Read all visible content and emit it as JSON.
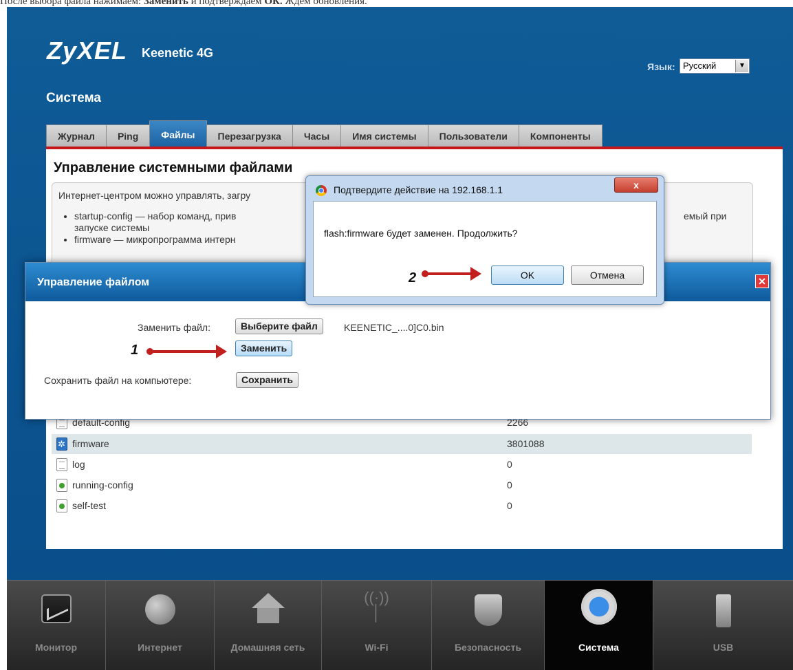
{
  "caption": {
    "before": "После выбора файла нажимаем: ",
    "bold1": "Заменить",
    "middle": " и подтверждаем ",
    "bold2": "ОК.",
    "after": " Ждем обновления."
  },
  "header": {
    "brand": "ZyXEL",
    "model": "Keenetic 4G",
    "language_label": "Язык:",
    "language_value": "Русский",
    "section_title": "Система"
  },
  "tabs": [
    "Журнал",
    "Ping",
    "Файлы",
    "Перезагрузка",
    "Часы",
    "Имя системы",
    "Пользователи",
    "Компоненты"
  ],
  "active_tab": "Файлы",
  "content": {
    "heading": "Управление системными файлами",
    "intro": "Интернет-центром можно управлять, загру",
    "items": [
      {
        "text": "startup-config — набор команд, прив",
        "suffix": "емый при",
        "cont": "запуске системы"
      },
      {
        "text": "firmware — микропрограмма интерн"
      }
    ]
  },
  "files": [
    {
      "name": "default-config",
      "size": "2266",
      "icon": "doc"
    },
    {
      "name": "firmware",
      "size": "3801088",
      "icon": "gear",
      "highlight": true
    },
    {
      "name": "log",
      "size": "0",
      "icon": "doc"
    },
    {
      "name": "running-config",
      "size": "0",
      "icon": "green"
    },
    {
      "name": "self-test",
      "size": "0",
      "icon": "green"
    }
  ],
  "file_dialog": {
    "title": "Управление файлом",
    "replace_label": "Заменить файл:",
    "choose_button": "Выберите файл",
    "chosen_file": "KEENETIC_....0]C0.bin",
    "replace_button": "Заменить",
    "save_label": "Сохранить файл на компьютере:",
    "save_button": "Сохранить"
  },
  "confirm": {
    "title": "Подтвердите действие на 192.168.1.1",
    "close": "x",
    "message": "flash:firmware будет заменен. Продолжить?",
    "ok": "OK",
    "cancel": "Отмена"
  },
  "steps": [
    "1",
    "2"
  ],
  "bottom_nav": [
    {
      "label": "Монитор",
      "icon": "monitor-icon"
    },
    {
      "label": "Интернет",
      "icon": "globe-icon"
    },
    {
      "label": "Домашняя сеть",
      "icon": "home-icon"
    },
    {
      "label": "Wi-Fi",
      "icon": "wifi-icon"
    },
    {
      "label": "Безопасность",
      "icon": "shield-icon"
    },
    {
      "label": "Система",
      "icon": "gear-icon",
      "active": true
    },
    {
      "label": "USB",
      "icon": "usb-icon"
    }
  ],
  "colors": {
    "background": "#0b5390",
    "accent_red": "#c8161d",
    "active_tab": "#1c63a3",
    "arrow": "#c21f1f"
  }
}
